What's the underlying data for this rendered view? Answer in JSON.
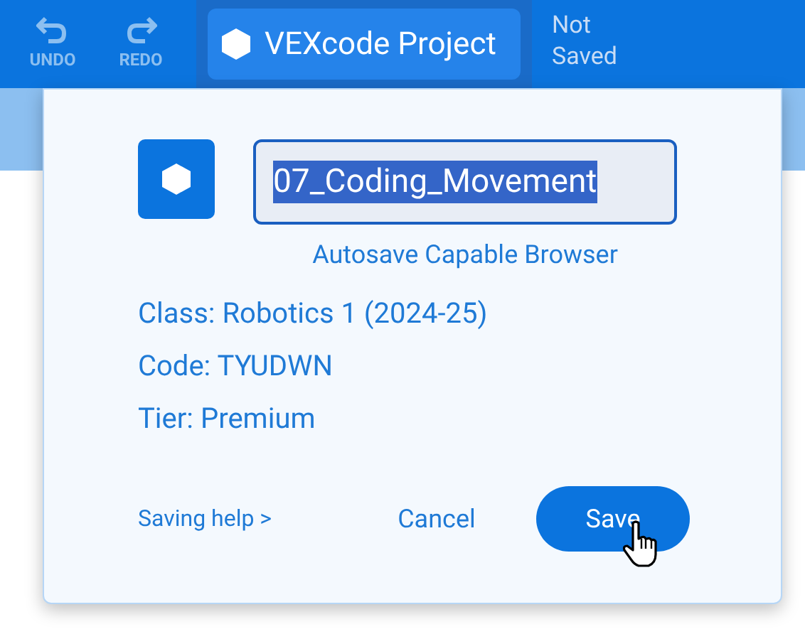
{
  "toolbar": {
    "buttons": [
      {
        "kind": "undo",
        "label": "UNDO",
        "disabled": true
      },
      {
        "kind": "redo",
        "label": "REDO",
        "disabled": true
      }
    ],
    "project_button": {
      "label": "VEXcode Project"
    },
    "save_status": [
      "Not",
      "Saved"
    ]
  },
  "dialog": {
    "project_name": {
      "value": "07_Coding_Movement",
      "text_selected": true
    },
    "hint": "Autosave Capable Browser",
    "details": [
      "Class: Robotics 1 (2024-25)",
      "Code: TYUDWN",
      "Tier: Premium"
    ],
    "help_link": "Saving help >",
    "buttons": [
      {
        "kind": "secondary",
        "label": "Cancel"
      },
      {
        "kind": "primary",
        "label": "Save"
      }
    ]
  }
}
